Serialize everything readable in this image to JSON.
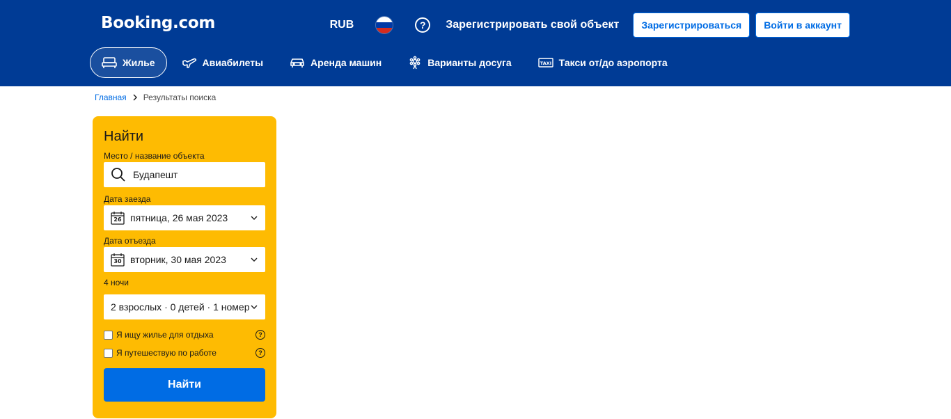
{
  "header": {
    "logo": "Booking.com",
    "currency": "RUB",
    "register_property": "Зарегистрировать свой объект",
    "register_button": "Зарегистрироваться",
    "login_button": "Войти в аккаунт",
    "help_icon": "question-circle-icon",
    "flag_colors": [
      "#ffffff",
      "#0039a6",
      "#d52b1e"
    ],
    "brand_color": "#003b95"
  },
  "nav": {
    "items": [
      {
        "label": "Жилье",
        "icon": "bed-icon",
        "active": true
      },
      {
        "label": "Авиабилеты",
        "icon": "plane-icon",
        "active": false
      },
      {
        "label": "Аренда машин",
        "icon": "car-icon",
        "active": false
      },
      {
        "label": "Варианты досуга",
        "icon": "attractions-icon",
        "active": false
      },
      {
        "label": "Такси от/до аэропорта",
        "icon": "taxi-icon",
        "active": false
      }
    ]
  },
  "breadcrumb": {
    "home": "Главная",
    "current": "Результаты поиска"
  },
  "search": {
    "title": "Найти",
    "destination_label": "Место / название объекта",
    "destination_value": "Будапешт",
    "checkin_label": "Дата заезда",
    "checkin_value": "пятница, 26 мая 2023",
    "checkin_day": "26",
    "checkout_label": "Дата отъезда",
    "checkout_value": "вторник, 30 мая 2023",
    "checkout_day": "30",
    "nights": "4 ночи",
    "guests_value": "2 взрослых · 0 детей · 1 номер",
    "leisure_label": "Я ищу жилье для отдыха",
    "work_label": "Я путешествую по работе",
    "submit_label": "Найти",
    "accent_color": "#febb02",
    "button_color": "#006ce4"
  }
}
